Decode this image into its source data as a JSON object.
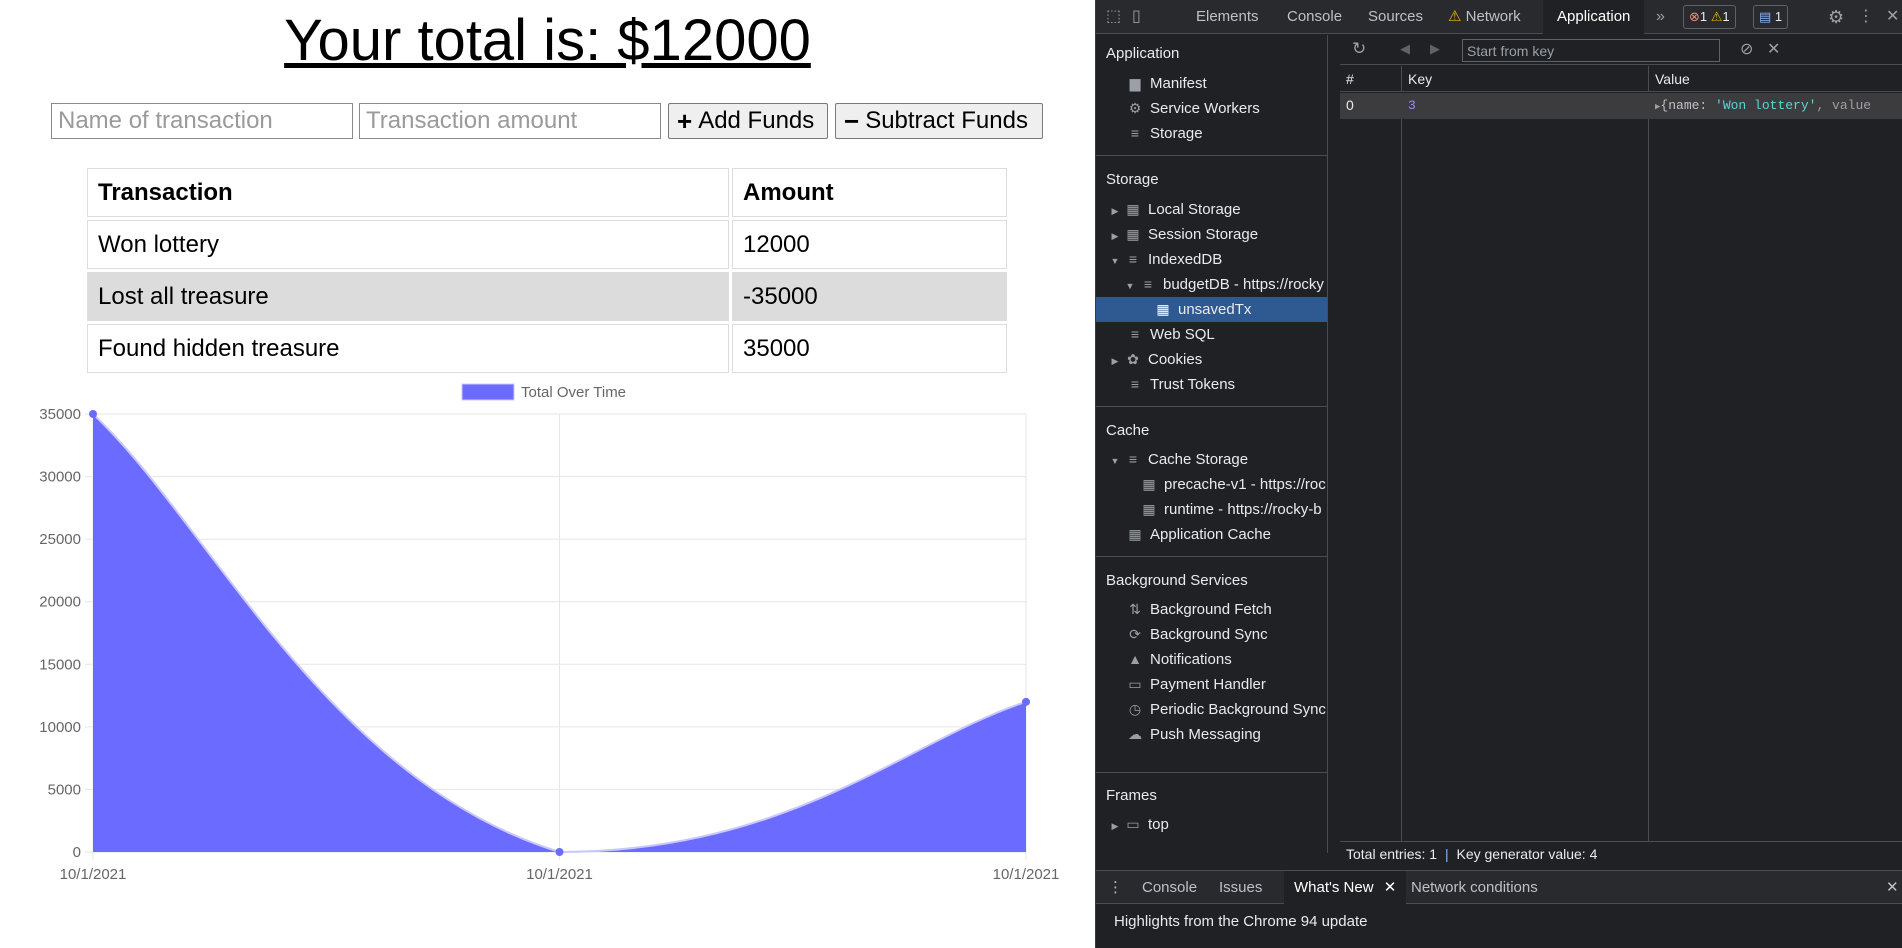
{
  "app": {
    "total_label": "Your total is: $12000",
    "name_placeholder": "Name of transaction",
    "amount_placeholder": "Transaction amount",
    "add_label": "Add Funds",
    "subtract_label": "Subtract Funds",
    "table": {
      "headers": [
        "Transaction",
        "Amount"
      ],
      "rows": [
        {
          "name": "Won lottery",
          "amount": "12000"
        },
        {
          "name": "Lost all treasure",
          "amount": "-35000"
        },
        {
          "name": "Found hidden treasure",
          "amount": "35000"
        }
      ]
    }
  },
  "chart_data": {
    "type": "area",
    "legend": "Total Over Time",
    "categories": [
      "10/1/2021",
      "10/1/2021",
      "10/1/2021"
    ],
    "series": [
      {
        "name": "Total Over Time",
        "values": [
          35000,
          0,
          12000
        ]
      }
    ],
    "ylim": [
      0,
      35000
    ],
    "yticks": [
      "35000",
      "30000",
      "25000",
      "20000",
      "15000",
      "10000",
      "5000",
      "0"
    ],
    "grid": true,
    "legend_position": "top",
    "color": "#6b6bff"
  },
  "devtools": {
    "tabs": [
      "Elements",
      "Console",
      "Sources",
      "Network",
      "Application"
    ],
    "active_tab": "Application",
    "badges": {
      "errors": "1",
      "warnings": "1",
      "messages": "1"
    },
    "sidebar": {
      "application_title": "Application",
      "application_items": [
        "Manifest",
        "Service Workers",
        "Storage"
      ],
      "storage_title": "Storage",
      "storage_items": [
        "Local Storage",
        "Session Storage",
        "IndexedDB",
        "budgetDB - https://rocky",
        "unsavedTx",
        "Web SQL",
        "Cookies",
        "Trust Tokens"
      ],
      "cache_title": "Cache",
      "cache_items": [
        "Cache Storage",
        "precache-v1 - https://roc",
        "runtime - https://rocky-b",
        "Application Cache"
      ],
      "bg_title": "Background Services",
      "bg_items": [
        "Background Fetch",
        "Background Sync",
        "Notifications",
        "Payment Handler",
        "Periodic Background Sync",
        "Push Messaging"
      ],
      "frames_title": "Frames",
      "frames_items": [
        "top"
      ]
    },
    "toolbar": {
      "key_placeholder": "Start from key"
    },
    "grid": {
      "headers": [
        "#",
        "Key",
        "Value"
      ],
      "row": {
        "index": "0",
        "key": "3",
        "value_prefix": "{name: ",
        "value_string": "'Won lottery'",
        "value_suffix": ", value"
      }
    },
    "status": {
      "entries": "Total entries: 1",
      "keygen": "Key generator value: 4"
    },
    "drawer": {
      "tabs": [
        "Console",
        "Issues",
        "What's New",
        "Network conditions"
      ],
      "active": "What's New",
      "body": "Highlights from the Chrome 94 update"
    },
    "colors": {
      "selected": "#2f5a91",
      "accent": "#8ab4f8",
      "string": "#5cd5d5",
      "key": "#9b8cf7"
    }
  }
}
